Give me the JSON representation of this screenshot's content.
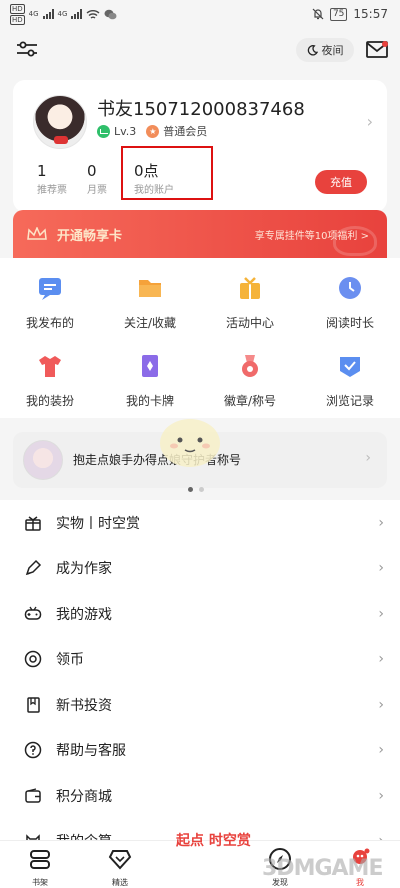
{
  "status_bar": {
    "time": "15:57",
    "battery": "75",
    "network": "4G",
    "sim_labels": [
      "HD",
      "HD"
    ]
  },
  "top_bar": {
    "night_mode_label": "夜间"
  },
  "profile": {
    "username": "书友150712000837468",
    "level": "Lv.3",
    "membership": "普通会员",
    "stats": [
      {
        "value": "1",
        "label": "推荐票"
      },
      {
        "value": "0",
        "label": "月票"
      },
      {
        "value": "0点",
        "label": "我的账户"
      }
    ],
    "recharge_label": "充值"
  },
  "vip_banner": {
    "title": "开通畅享卡",
    "desc": "享专属挂件等10项福利 >"
  },
  "grid": {
    "items": [
      {
        "label": "我发布的",
        "icon": "message-icon",
        "color": "#5b8ef0"
      },
      {
        "label": "关注/收藏",
        "icon": "folder-icon",
        "color": "#f5a23a"
      },
      {
        "label": "活动中心",
        "icon": "gift-icon",
        "color": "#f5b33a"
      },
      {
        "label": "阅读时长",
        "icon": "clock-icon",
        "color": "#6b8ff0"
      },
      {
        "label": "我的装扮",
        "icon": "shirt-icon",
        "color": "#f05a5a"
      },
      {
        "label": "我的卡牌",
        "icon": "card-icon",
        "color": "#8b6be8"
      },
      {
        "label": "徽章/称号",
        "icon": "medal-icon",
        "color": "#f06a6a"
      },
      {
        "label": "浏览记录",
        "icon": "history-icon",
        "color": "#5b8ef0"
      }
    ]
  },
  "promo": {
    "text": "抱走点娘手办得点娘守护者称号",
    "avatar_label": "时空赏"
  },
  "menu": {
    "items": [
      {
        "label": "实物丨时空赏",
        "icon": "gift-outline-icon"
      },
      {
        "label": "成为作家",
        "icon": "pen-icon"
      },
      {
        "label": "我的游戏",
        "icon": "gamepad-icon"
      },
      {
        "label": "领币",
        "icon": "coin-icon"
      },
      {
        "label": "新书投资",
        "icon": "book-icon"
      },
      {
        "label": "帮助与客服",
        "icon": "help-icon"
      },
      {
        "label": "积分商城",
        "icon": "wallet-icon"
      },
      {
        "label": "我的企算",
        "icon": "cat-icon"
      }
    ]
  },
  "bottom_nav": {
    "items": [
      {
        "label": "书架",
        "icon": "bookshelf-icon"
      },
      {
        "label": "精选",
        "icon": "diamond-icon"
      },
      {
        "label": "发现",
        "icon": "compass-icon"
      },
      {
        "label": "我",
        "icon": "profile-icon"
      }
    ],
    "brand_watermark": "起点 时空赏",
    "site_watermark": "3DMGAME"
  },
  "colors": {
    "accent": "#e8423d",
    "highlight_border": "#d11111"
  }
}
